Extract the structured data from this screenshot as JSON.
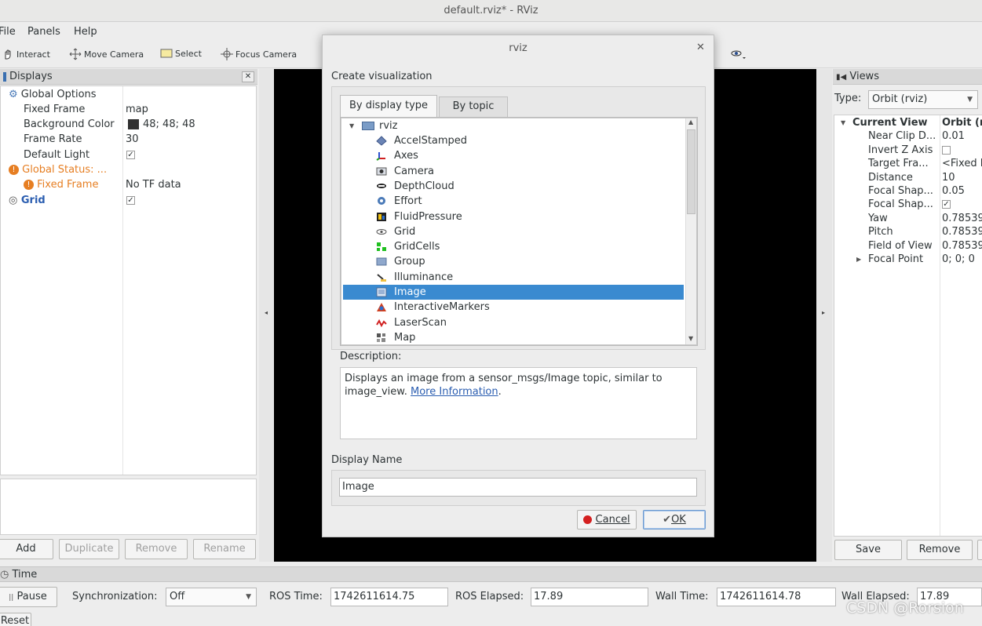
{
  "window": {
    "title": "default.rviz* - RViz"
  },
  "menu": {
    "file": "File",
    "panels": "Panels",
    "help": "Help"
  },
  "toolbar": {
    "interact": "Interact",
    "move_camera": "Move Camera",
    "select": "Select",
    "focus_camera": "Focus Camera"
  },
  "displays": {
    "header": "Displays",
    "rows": {
      "global_options": "Global Options",
      "fixed_frame": "Fixed Frame",
      "fixed_frame_value": "map",
      "background_color": "Background Color",
      "background_color_value": "48; 48; 48",
      "frame_rate": "Frame Rate",
      "frame_rate_value": "30",
      "default_light": "Default Light",
      "global_status": "Global Status: ...",
      "status_fixed_frame": "Fixed Frame",
      "status_fixed_frame_value": "No TF data",
      "grid": "Grid"
    },
    "buttons": {
      "add": "Add",
      "duplicate": "Duplicate",
      "remove": "Remove",
      "rename": "Rename"
    }
  },
  "views": {
    "header": "Views",
    "type_label": "Type:",
    "type_value": "Orbit (rviz)",
    "rows": [
      {
        "name": "Current View",
        "value": "Orbit (rv"
      },
      {
        "name": "Near Clip D...",
        "value": "0.01"
      },
      {
        "name": "Invert Z Axis",
        "value": ""
      },
      {
        "name": "Target Fra...",
        "value": "<Fixed F"
      },
      {
        "name": "Distance",
        "value": "10"
      },
      {
        "name": "Focal Shap...",
        "value": "0.05"
      },
      {
        "name": "Focal Shap...",
        "value": ""
      },
      {
        "name": "Yaw",
        "value": "0.78539"
      },
      {
        "name": "Pitch",
        "value": "0.78539"
      },
      {
        "name": "Field of View",
        "value": "0.78539"
      },
      {
        "name": "Focal Point",
        "value": "0; 0; 0"
      }
    ],
    "buttons": {
      "save": "Save",
      "remove": "Remove"
    }
  },
  "time": {
    "header": "Time",
    "pause": "Pause",
    "sync_label": "Synchronization:",
    "sync_value": "Off",
    "ros_time_label": "ROS Time:",
    "ros_time": "1742611614.75",
    "ros_elapsed_label": "ROS Elapsed:",
    "ros_elapsed": "17.89",
    "wall_time_label": "Wall Time:",
    "wall_time": "1742611614.78",
    "wall_elapsed_label": "Wall Elapsed:",
    "wall_elapsed": "17.89",
    "reset": "Reset"
  },
  "dialog": {
    "title": "rviz",
    "section_label": "Create visualization",
    "tabs": [
      "By display type",
      "By topic"
    ],
    "tree_root": "rviz",
    "items": [
      "AccelStamped",
      "Axes",
      "Camera",
      "DepthCloud",
      "Effort",
      "FluidPressure",
      "Grid",
      "GridCells",
      "Group",
      "Illuminance",
      "Image",
      "InteractiveMarkers",
      "LaserScan",
      "Map"
    ],
    "selected_item": "Image",
    "description_label": "Description:",
    "description_text": "Displays an image from a sensor_msgs/Image topic, similar to image_view.",
    "description_link": "More Information",
    "description_tail": ".",
    "display_name_label": "Display Name",
    "display_name_value": "Image",
    "cancel": "Cancel",
    "ok": "OK"
  },
  "watermark": "CSDN @Rorsion",
  "colors": {
    "accent": "#3a8ad0",
    "warning": "#e67e22",
    "link": "#2a5db0",
    "viewport": "#000000"
  }
}
